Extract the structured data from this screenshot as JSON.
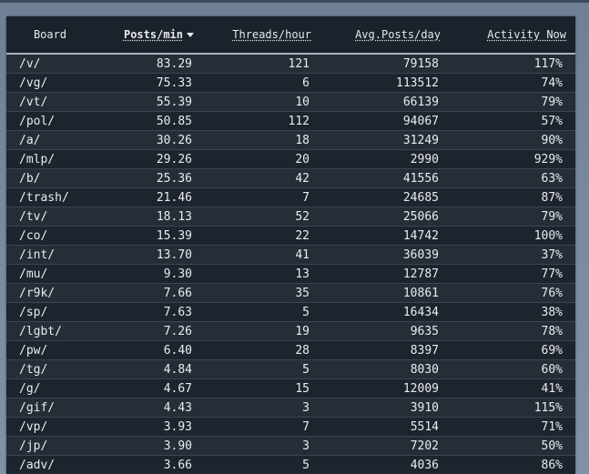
{
  "table": {
    "headers": [
      "Board",
      "Posts/min",
      "Threads/hour",
      "Avg.Posts/day",
      "Activity Now"
    ],
    "sorted_column": "Posts/min",
    "rows": [
      [
        "/v/",
        "83.29",
        "121",
        "79158",
        "117%"
      ],
      [
        "/vg/",
        "75.33",
        "6",
        "113512",
        "74%"
      ],
      [
        "/vt/",
        "55.39",
        "10",
        "66139",
        "79%"
      ],
      [
        "/pol/",
        "50.85",
        "112",
        "94067",
        "57%"
      ],
      [
        "/a/",
        "30.26",
        "18",
        "31249",
        "90%"
      ],
      [
        "/mlp/",
        "29.26",
        "20",
        "2990",
        "929%"
      ],
      [
        "/b/",
        "25.36",
        "42",
        "41556",
        "63%"
      ],
      [
        "/trash/",
        "21.46",
        "7",
        "24685",
        "87%"
      ],
      [
        "/tv/",
        "18.13",
        "52",
        "25066",
        "79%"
      ],
      [
        "/co/",
        "15.39",
        "22",
        "14742",
        "100%"
      ],
      [
        "/int/",
        "13.70",
        "41",
        "36039",
        "37%"
      ],
      [
        "/mu/",
        "9.30",
        "13",
        "12787",
        "77%"
      ],
      [
        "/r9k/",
        "7.66",
        "35",
        "10861",
        "76%"
      ],
      [
        "/sp/",
        "7.63",
        "5",
        "16434",
        "38%"
      ],
      [
        "/lgbt/",
        "7.26",
        "19",
        "9635",
        "78%"
      ],
      [
        "/pw/",
        "6.40",
        "28",
        "8397",
        "69%"
      ],
      [
        "/tg/",
        "4.84",
        "5",
        "8030",
        "60%"
      ],
      [
        "/g/",
        "4.67",
        "15",
        "12009",
        "41%"
      ],
      [
        "/gif/",
        "4.43",
        "3",
        "3910",
        "115%"
      ],
      [
        "/vp/",
        "3.93",
        "7",
        "5514",
        "71%"
      ],
      [
        "/jp/",
        "3.90",
        "3",
        "7202",
        "50%"
      ],
      [
        "/adv/",
        "3.66",
        "5",
        "4036",
        "86%"
      ]
    ]
  }
}
